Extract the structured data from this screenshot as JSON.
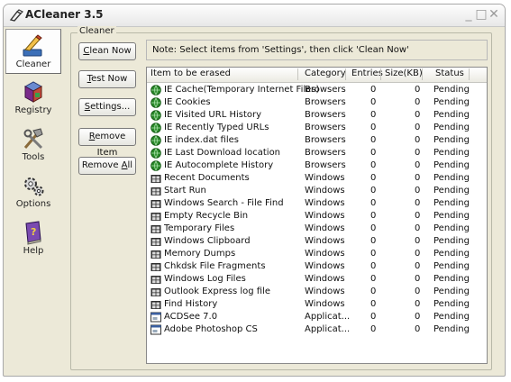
{
  "window": {
    "title": "ACleaner 3.5"
  },
  "titlebar_buttons": {
    "minimize": "_",
    "maximize": "□",
    "close": "✕"
  },
  "sidebar": {
    "items": [
      {
        "label": "Cleaner",
        "icon": "brush-icon",
        "active": true
      },
      {
        "label": "Registry",
        "icon": "registry-cube-icon"
      },
      {
        "label": "Tools",
        "icon": "tools-icon"
      },
      {
        "label": "Options",
        "icon": "gears-icon"
      },
      {
        "label": "Help",
        "icon": "help-book-icon"
      }
    ]
  },
  "group": {
    "label": "Cleaner"
  },
  "buttons": [
    {
      "key": "C",
      "rest": "lean Now"
    },
    {
      "key": "T",
      "rest": "est Now"
    },
    {
      "key": "S",
      "rest": "ettings..."
    },
    {
      "key": "R",
      "rest": "emove Item"
    },
    {
      "pre": "Remove ",
      "key": "A",
      "rest": "ll"
    }
  ],
  "note": "Note: Select items from 'Settings', then click 'Clean Now'",
  "table": {
    "columns": [
      "Item to be erased",
      "Category",
      "Entries",
      "Size(KB)",
      "Status"
    ],
    "rows": [
      {
        "icon": "ie-globe-icon",
        "item": "IE Cache(Temporary Internet Files)",
        "category": "Browsers",
        "entries": "0",
        "size": "0",
        "status": "Pending"
      },
      {
        "icon": "ie-globe-icon",
        "item": "IE Cookies",
        "category": "Browsers",
        "entries": "0",
        "size": "0",
        "status": "Pending"
      },
      {
        "icon": "ie-globe-icon",
        "item": "IE Visited URL History",
        "category": "Browsers",
        "entries": "0",
        "size": "0",
        "status": "Pending"
      },
      {
        "icon": "ie-globe-icon",
        "item": "IE Recently Typed URLs",
        "category": "Browsers",
        "entries": "0",
        "size": "0",
        "status": "Pending"
      },
      {
        "icon": "ie-globe-icon",
        "item": "IE index.dat files",
        "category": "Browsers",
        "entries": "0",
        "size": "0",
        "status": "Pending"
      },
      {
        "icon": "ie-globe-icon",
        "item": "IE Last Download location",
        "category": "Browsers",
        "entries": "0",
        "size": "0",
        "status": "Pending"
      },
      {
        "icon": "ie-globe-icon",
        "item": "IE Autocomplete History",
        "category": "Browsers",
        "entries": "0",
        "size": "0",
        "status": "Pending"
      },
      {
        "icon": "windows-flag-icon",
        "item": "Recent Documents",
        "category": "Windows",
        "entries": "0",
        "size": "0",
        "status": "Pending"
      },
      {
        "icon": "windows-flag-icon",
        "item": "Start Run",
        "category": "Windows",
        "entries": "0",
        "size": "0",
        "status": "Pending"
      },
      {
        "icon": "windows-flag-icon",
        "item": "Windows Search - File Find",
        "category": "Windows",
        "entries": "0",
        "size": "0",
        "status": "Pending"
      },
      {
        "icon": "windows-flag-icon",
        "item": "Empty Recycle Bin",
        "category": "Windows",
        "entries": "0",
        "size": "0",
        "status": "Pending"
      },
      {
        "icon": "windows-flag-icon",
        "item": "Temporary Files",
        "category": "Windows",
        "entries": "0",
        "size": "0",
        "status": "Pending"
      },
      {
        "icon": "windows-flag-icon",
        "item": "Windows Clipboard",
        "category": "Windows",
        "entries": "0",
        "size": "0",
        "status": "Pending"
      },
      {
        "icon": "windows-flag-icon",
        "item": "Memory Dumps",
        "category": "Windows",
        "entries": "0",
        "size": "0",
        "status": "Pending"
      },
      {
        "icon": "windows-flag-icon",
        "item": "Chkdsk File Fragments",
        "category": "Windows",
        "entries": "0",
        "size": "0",
        "status": "Pending"
      },
      {
        "icon": "windows-flag-icon",
        "item": "Windows Log Files",
        "category": "Windows",
        "entries": "0",
        "size": "0",
        "status": "Pending"
      },
      {
        "icon": "windows-flag-icon",
        "item": "Outlook Express log file",
        "category": "Windows",
        "entries": "0",
        "size": "0",
        "status": "Pending"
      },
      {
        "icon": "windows-flag-icon",
        "item": "Find History",
        "category": "Windows",
        "entries": "0",
        "size": "0",
        "status": "Pending"
      },
      {
        "icon": "application-window-icon",
        "item": "ACDSee 7.0",
        "category": "Applicat...",
        "entries": "0",
        "size": "0",
        "status": "Pending"
      },
      {
        "icon": "application-window-icon",
        "item": "Adobe Photoshop CS",
        "category": "Applicat...",
        "entries": "0",
        "size": "0",
        "status": "Pending"
      }
    ]
  },
  "colors": {
    "window_bg": "#ece9d8",
    "list_bg": "#ffffff",
    "ie_icon": "#2a8a2a",
    "app_icon": "#3a5fa0"
  }
}
